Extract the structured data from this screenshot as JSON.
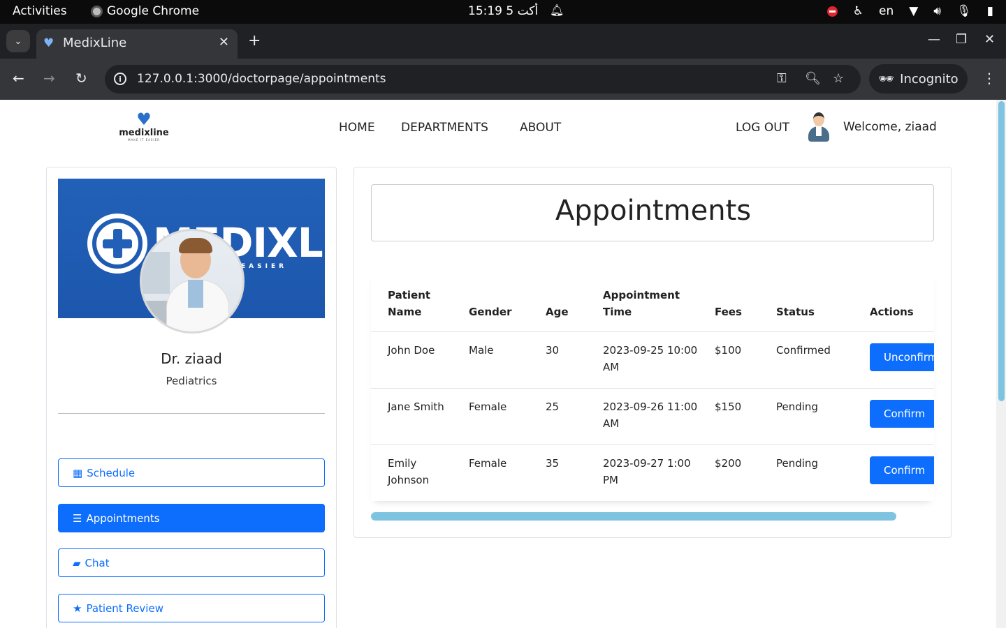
{
  "os": {
    "activities": "Activities",
    "app_name": "Google Chrome",
    "clock": "15:19  5 أكت",
    "lang": "en"
  },
  "browser": {
    "tab_title": "MedixLine",
    "url": "127.0.0.1:3000/doctorpage/appointments",
    "incognito_label": "Incognito"
  },
  "site": {
    "logo_word": "medixline",
    "logo_tagline": "MAKE IT EASIER",
    "nav": [
      {
        "label": "HOME"
      },
      {
        "label": "DEPARTMENTS"
      },
      {
        "label": "ABOUT"
      }
    ],
    "logout_label": "LOG OUT",
    "welcome": "Welcome, ziaad"
  },
  "profile": {
    "banner_brand": "MEDIXLINE",
    "banner_slogan": "EASIER",
    "name": "Dr. ziaad",
    "department": "Pediatrics",
    "menu": [
      {
        "label": "Schedule",
        "icon": "calendar-icon",
        "active": false
      },
      {
        "label": "Appointments",
        "icon": "list-icon",
        "active": true
      },
      {
        "label": "Chat",
        "icon": "chat-icon",
        "active": false
      },
      {
        "label": "Patient Review",
        "icon": "star-icon",
        "active": false
      }
    ]
  },
  "appointments": {
    "title": "Appointments",
    "headers": [
      "Patient Name",
      "Gender",
      "Age",
      "Appointment Time",
      "Fees",
      "Status",
      "Actions"
    ],
    "rows": [
      {
        "patient": "John Doe",
        "gender": "Male",
        "age": "30",
        "time": "2023-09-25 10:00 AM",
        "fees": "$100",
        "status": "Confirmed",
        "action": "Unconfirm"
      },
      {
        "patient": "Jane Smith",
        "gender": "Female",
        "age": "25",
        "time": "2023-09-26 11:00 AM",
        "fees": "$150",
        "status": "Pending",
        "action": "Confirm"
      },
      {
        "patient": "Emily Johnson",
        "gender": "Female",
        "age": "35",
        "time": "2023-09-27 1:00 PM",
        "fees": "$200",
        "status": "Pending",
        "action": "Confirm"
      }
    ]
  },
  "colors": {
    "primary": "#0d6efd",
    "banner": "#2260b8",
    "scroll_thumb": "#7ec4e0"
  }
}
